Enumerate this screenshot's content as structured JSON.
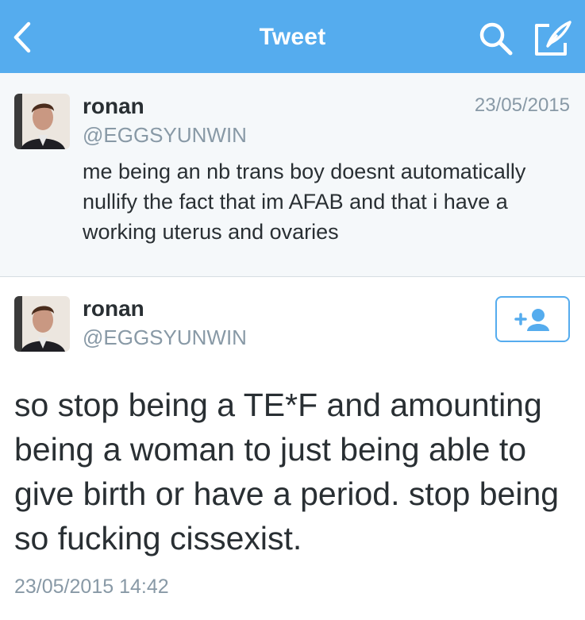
{
  "header": {
    "title": "Tweet",
    "background_color": "#55acee",
    "icons": [
      "back-chevron-icon",
      "search-icon",
      "compose-icon"
    ]
  },
  "parent_tweet": {
    "name": "ronan",
    "handle": "@EGGSYUNWIN",
    "date": "23/05/2015",
    "text": "me being an nb trans boy doesnt automatically nullify the fact that im AFAB and that i have a working uterus and ovaries"
  },
  "main_tweet": {
    "name": "ronan",
    "handle": "@EGGSYUNWIN",
    "text": "so stop being a TE*F and amounting being a woman to just being able to give birth or have a period. stop being so fucking cissexist.",
    "timestamp": "23/05/2015 14:42",
    "follow_icon": "add-user-icon"
  },
  "colors": {
    "accent": "#55acee",
    "text": "#292f33",
    "secondary_text": "#8899a6",
    "parent_background": "#f5f8fa"
  }
}
